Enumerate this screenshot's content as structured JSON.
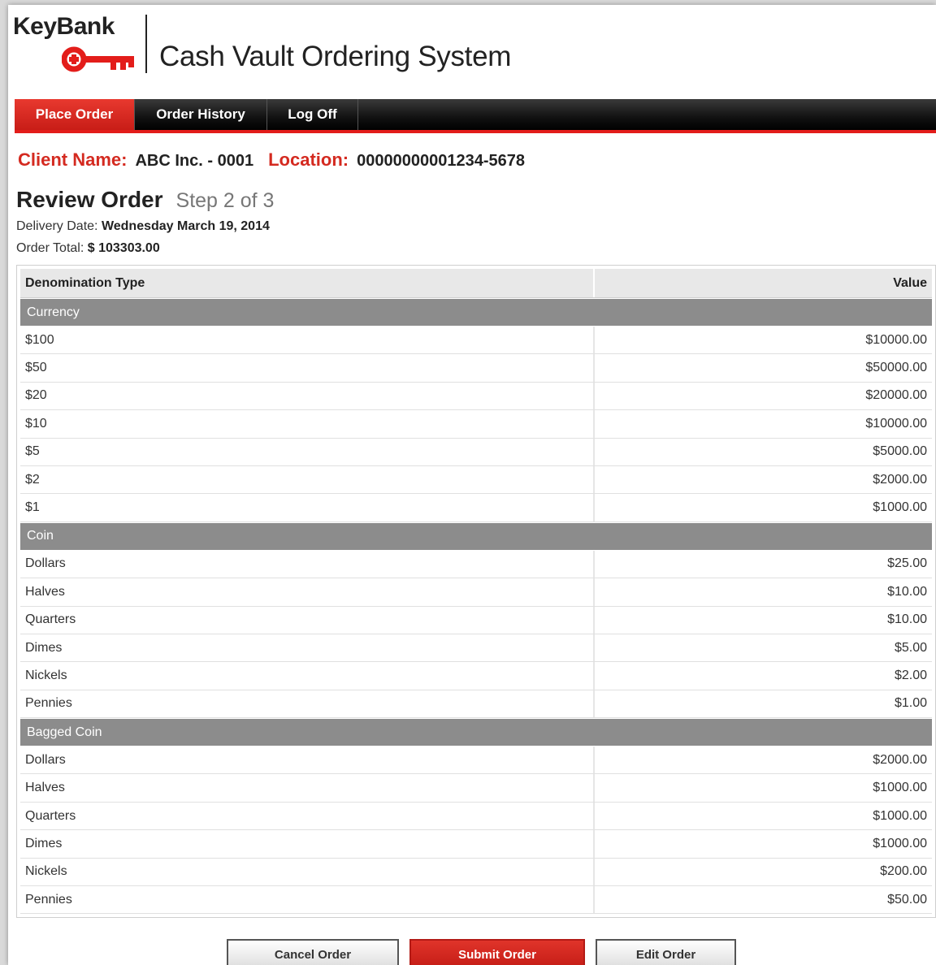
{
  "brand": {
    "logo_text": "KeyBank",
    "app_title": "Cash Vault Ordering System",
    "accent_color": "#e31d1a"
  },
  "nav": {
    "tabs": [
      {
        "label": "Place Order",
        "active": true
      },
      {
        "label": "Order History",
        "active": false
      },
      {
        "label": "Log Off",
        "active": false
      }
    ]
  },
  "client": {
    "name_label": "Client Name:",
    "name_value": "ABC Inc. - 0001",
    "location_label": "Location:",
    "location_value": "00000000001234-5678"
  },
  "review": {
    "title": "Review Order",
    "step": "Step 2 of 3",
    "delivery_label": "Delivery Date:",
    "delivery_value": "Wednesday March 19, 2014",
    "total_label": "Order Total:",
    "total_value": "$ 103303.00"
  },
  "table": {
    "col_denomination": "Denomination Type",
    "col_value": "Value",
    "sections": [
      {
        "name": "Currency",
        "rows": [
          {
            "denom": "$100",
            "value": "$10000.00"
          },
          {
            "denom": "$50",
            "value": "$50000.00"
          },
          {
            "denom": "$20",
            "value": "$20000.00"
          },
          {
            "denom": "$10",
            "value": "$10000.00"
          },
          {
            "denom": "$5",
            "value": "$5000.00"
          },
          {
            "denom": "$2",
            "value": "$2000.00"
          },
          {
            "denom": "$1",
            "value": "$1000.00"
          }
        ]
      },
      {
        "name": "Coin",
        "rows": [
          {
            "denom": "Dollars",
            "value": "$25.00"
          },
          {
            "denom": "Halves",
            "value": "$10.00"
          },
          {
            "denom": "Quarters",
            "value": "$10.00"
          },
          {
            "denom": "Dimes",
            "value": "$5.00"
          },
          {
            "denom": "Nickels",
            "value": "$2.00"
          },
          {
            "denom": "Pennies",
            "value": "$1.00"
          }
        ]
      },
      {
        "name": "Bagged Coin",
        "rows": [
          {
            "denom": "Dollars",
            "value": "$2000.00"
          },
          {
            "denom": "Halves",
            "value": "$1000.00"
          },
          {
            "denom": "Quarters",
            "value": "$1000.00"
          },
          {
            "denom": "Dimes",
            "value": "$1000.00"
          },
          {
            "denom": "Nickels",
            "value": "$200.00"
          },
          {
            "denom": "Pennies",
            "value": "$50.00"
          }
        ]
      }
    ]
  },
  "buttons": {
    "cancel": "Cancel Order",
    "submit": "Submit Order",
    "edit": "Edit Order"
  },
  "icons": {
    "logo_mark": "key-icon"
  }
}
